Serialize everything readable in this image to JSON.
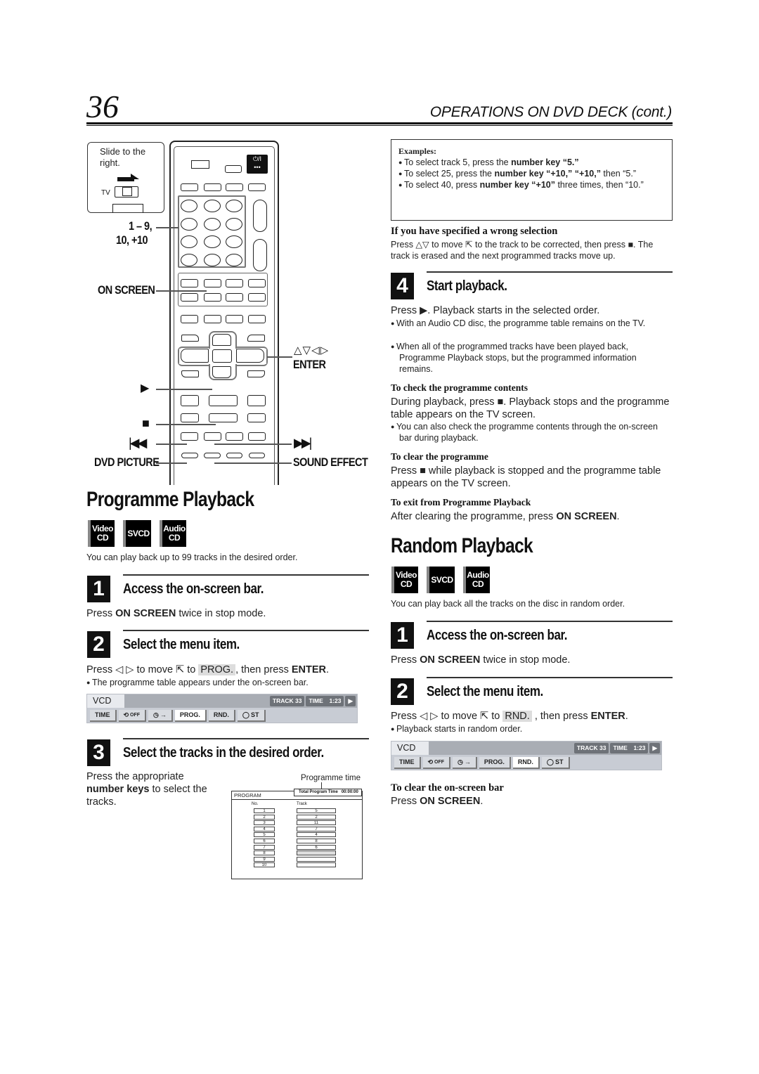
{
  "header": {
    "page_number": "36",
    "section_title": "OPERATIONS ON DVD DECK (cont.)"
  },
  "remote": {
    "callout_text": "Slide to the right.",
    "switch_label": "TV",
    "power_label": "⏻/I",
    "labels": {
      "number_keys": "1 – 9,",
      "number_keys2": "10, +10",
      "on_screen": "ON SCREEN",
      "arrows": "△▽◁▷",
      "enter": "ENTER",
      "play": "▶",
      "stop": "■",
      "prev": "⏮",
      "next": "⏭",
      "dvd_picture": "DVD PICTURE",
      "sound_effect": "SOUND EFFECT"
    }
  },
  "programme": {
    "title": "Programme Playback",
    "badges": [
      "Video CD",
      "SVCD",
      "Audio CD"
    ],
    "intro": "You can play back up to 99 tracks in the desired order.",
    "step1": {
      "num": "1",
      "title": "Access the on-screen bar.",
      "text_pre": "Press ",
      "text_bold": "ON SCREEN",
      "text_post": " twice in stop mode."
    },
    "step2": {
      "num": "2",
      "title": "Select the menu item.",
      "text_pre": "Press ◁ ▷ to move ⇱ to ",
      "text_hl": "PROG.",
      "text_mid": ", then press ",
      "text_bold": "ENTER",
      "text_post": ".",
      "bullet": "The programme table appears under the on-screen bar."
    },
    "step3": {
      "num": "3",
      "title": "Select the tracks in the desired order.",
      "text_pre": "Press the appropriate ",
      "text_bold": "number keys",
      "text_post": " to select the tracks.",
      "callout": "Programme time"
    },
    "program_table": {
      "tab_label": "PROGRAM",
      "total_label": "Total Program Time",
      "total_value": "00:00:00",
      "col_no": "No.",
      "col_track": "Track",
      "rows": [
        {
          "no": "1",
          "track": "5"
        },
        {
          "no": "2",
          "track": "2"
        },
        {
          "no": "3",
          "track": "11"
        },
        {
          "no": "4",
          "track": "7"
        },
        {
          "no": "5",
          "track": "4"
        },
        {
          "no": "6",
          "track": "8"
        },
        {
          "no": "7",
          "track": "6"
        },
        {
          "no": "8",
          "track": ""
        },
        {
          "no": "9",
          "track": ""
        },
        {
          "no": "10",
          "track": ""
        }
      ],
      "selected_row": 8
    }
  },
  "onscreen_bar": {
    "disc": "VCD",
    "track_label": "TRACK 33",
    "time_label": "TIME",
    "time_value": "1:23",
    "play_icon": "▶",
    "buttons": [
      "TIME",
      "OFF",
      "→",
      "PROG.",
      "RND.",
      "ST"
    ]
  },
  "right": {
    "examples": {
      "title": "Examples:",
      "items": [
        {
          "pre": "To select track 5, press the ",
          "bold": "number key “5.”",
          "post": ""
        },
        {
          "pre": "To select 25, press the ",
          "bold": "number key “+10,” “+10,”",
          "post": " then “5.”"
        },
        {
          "pre": "To select 40, press ",
          "bold": "number key “+10”",
          "post": " three times, then “10.”"
        }
      ]
    },
    "wrong": {
      "title": "If you have specified a wrong selection",
      "text": "Press △▽ to move ⇱ to the track to be corrected, then press ■. The track is erased and the next programmed tracks move up."
    },
    "step4": {
      "num": "4",
      "title": "Start playback.",
      "text": "Press ▶. Playback starts in the selected order.",
      "bullets": [
        "With an Audio CD disc, the programme table remains on the TV.",
        "When all of the programmed tracks have been played back, Programme Playback stops, but the programmed information remains."
      ]
    },
    "check": {
      "title": "To check the programme contents",
      "text": "During playback, press ■. Playback stops and the programme table appears on the TV screen.",
      "bullet": "You can also check the programme contents through the on-screen bar during playback."
    },
    "clear": {
      "title": "To clear the programme",
      "text": "Press ■ while playback is stopped and the programme table appears on the TV screen."
    },
    "exit": {
      "title": "To exit from Programme Playback",
      "text_pre": "After clearing the programme, press ",
      "text_bold": "ON SCREEN",
      "text_post": "."
    }
  },
  "random": {
    "title": "Random Playback",
    "badges": [
      "Video CD",
      "SVCD",
      "Audio CD"
    ],
    "intro": "You can play back all the tracks on the disc in random order.",
    "step1": {
      "num": "1",
      "title": "Access the on-screen bar.",
      "text_pre": "Press ",
      "text_bold": "ON SCREEN",
      "text_post": " twice in stop mode."
    },
    "step2": {
      "num": "2",
      "title": "Select the menu item.",
      "text_pre": "Press ◁ ▷ to move ⇱ to ",
      "text_hl": "RND.",
      "text_mid": " , then press ",
      "text_bold": "ENTER",
      "text_post": ".",
      "bullet": "Playback starts in random order."
    },
    "clear_bar": {
      "title": "To clear the on-screen bar",
      "text_pre": "Press ",
      "text_bold": "ON SCREEN",
      "text_post": "."
    }
  }
}
